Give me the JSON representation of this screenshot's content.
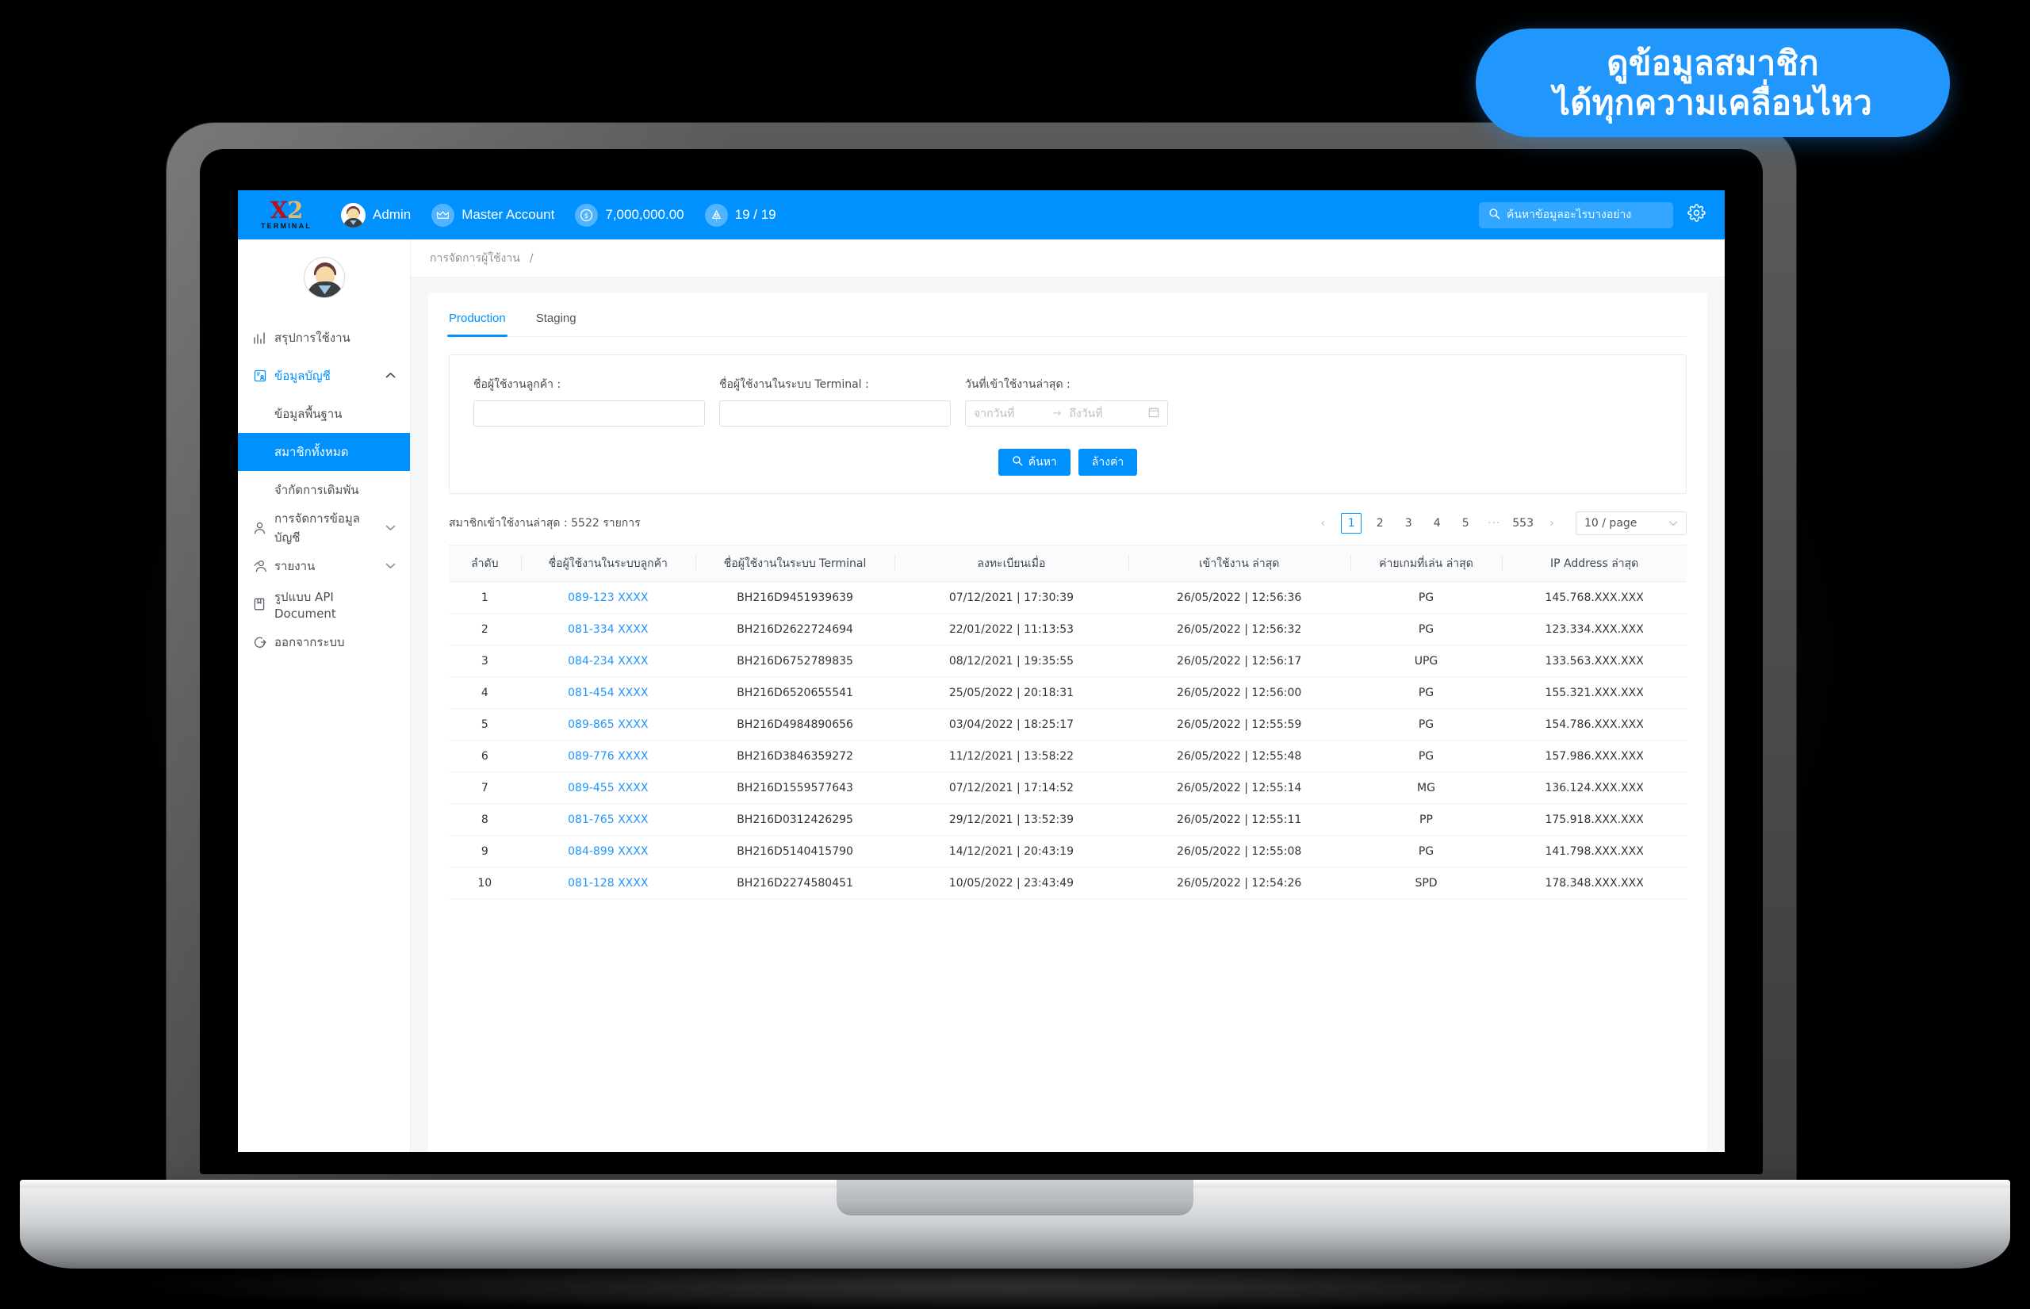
{
  "callout": {
    "line1": "ดูข้อมูลสมาชิก",
    "line2": "ได้ทุกความเคลื่อนไหว",
    "color": "#2196FC"
  },
  "header": {
    "logo_x": "X",
    "logo_two": "2",
    "logo_sub": "TERMINAL",
    "user_label": "Admin",
    "account_label": "Master Account",
    "balance": "7,000,000.00",
    "notify": "19 / 19",
    "search_placeholder": "ค้นหาข้อมูลอะไรบางอย่าง",
    "bg_color": "#0091FF",
    "icons": {
      "crown": "♛",
      "coin": "$",
      "bell": "△",
      "search": "search-icon",
      "gear": "gear-icon"
    }
  },
  "sidebar": {
    "items": [
      {
        "label": "สรุปการใช้งาน",
        "icon": "chart-bar-icon",
        "type": "item",
        "state": ""
      },
      {
        "label": "ข้อมูลบัญชี",
        "icon": "account-card-icon",
        "type": "group",
        "state": "open",
        "chevron": "⌃"
      },
      {
        "label": "ข้อมูลพื้นฐาน",
        "icon": "",
        "type": "sub",
        "state": ""
      },
      {
        "label": "สมาชิกทั้งหมด",
        "icon": "",
        "type": "sub",
        "state": "active"
      },
      {
        "label": "จำกัดการเดิมพัน",
        "icon": "",
        "type": "sub",
        "state": ""
      },
      {
        "label": "การจัดการข้อมูลบัญชี",
        "icon": "user-icon",
        "type": "group",
        "state": "",
        "chevron": "⌄"
      },
      {
        "label": "รายงาน",
        "icon": "users-report-icon",
        "type": "group",
        "state": "",
        "chevron": "⌄"
      },
      {
        "label": "รูปแบบ API Document",
        "icon": "book-icon",
        "type": "item",
        "state": ""
      },
      {
        "label": "ออกจากระบบ",
        "icon": "logout-icon",
        "type": "item",
        "state": ""
      }
    ]
  },
  "breadcrumb": {
    "item": "การจัดการผู้ใช้งาน",
    "separator": "/"
  },
  "tabs": [
    {
      "label": "Production",
      "active": true
    },
    {
      "label": "Staging",
      "active": false
    }
  ],
  "filters": {
    "customer_username": {
      "label": "ชื่อผู้ใช้งานลูกค้า :",
      "value": "",
      "placeholder": ""
    },
    "terminal_username": {
      "label": "ชื่อผู้ใช้งานในระบบ Terminal :",
      "value": "",
      "placeholder": ""
    },
    "last_login_date": {
      "label": "วันที่เข้าใช้งานล่าสุด :",
      "from_placeholder": "จากวันที่",
      "to_placeholder": "ถึงวันที่",
      "arrow": "→"
    },
    "search_button": "ค้นหา",
    "clear_button": "ล้างค่า"
  },
  "list": {
    "count_text": "สมาชิกเข้าใช้งานล่าสุด : 5522 รายการ",
    "pagination": {
      "prev": "‹",
      "next": "›",
      "pages": [
        "1",
        "2",
        "3",
        "4",
        "5"
      ],
      "dots": "···",
      "last": "553",
      "current": "1",
      "page_size": "10 / page",
      "chevron": "⌄"
    },
    "columns": [
      "ลำดับ",
      "ชื่อผู้ใช้งานในระบบลูกค้า",
      "ชื่อผู้ใช้งานในระบบ Terminal",
      "ลงทะเบียนเมื่อ",
      "เข้าใช้งาน ล่าสุด",
      "ค่ายเกมที่เล่น ล่าสุด",
      "IP Address ล่าสุด"
    ],
    "rows": [
      {
        "no": "1",
        "customer": "089-123 XXXX",
        "terminal": "BH216D9451939639",
        "registered": "07/12/2021 | 17:30:39",
        "last_login": "26/05/2022 | 12:56:36",
        "camp": "PG",
        "ip": "145.768.XXX.XXX"
      },
      {
        "no": "2",
        "customer": "081-334 XXXX",
        "terminal": "BH216D2622724694",
        "registered": "22/01/2022 | 11:13:53",
        "last_login": "26/05/2022 | 12:56:32",
        "camp": "PG",
        "ip": "123.334.XXX.XXX"
      },
      {
        "no": "3",
        "customer": "084-234 XXXX",
        "terminal": "BH216D6752789835",
        "registered": "08/12/2021 | 19:35:55",
        "last_login": "26/05/2022 | 12:56:17",
        "camp": "UPG",
        "ip": "133.563.XXX.XXX"
      },
      {
        "no": "4",
        "customer": "081-454 XXXX",
        "terminal": "BH216D6520655541",
        "registered": "25/05/2022 | 20:18:31",
        "last_login": "26/05/2022 | 12:56:00",
        "camp": "PG",
        "ip": "155.321.XXX.XXX"
      },
      {
        "no": "5",
        "customer": "089-865 XXXX",
        "terminal": "BH216D4984890656",
        "registered": "03/04/2022 | 18:25:17",
        "last_login": "26/05/2022 | 12:55:59",
        "camp": "PG",
        "ip": "154.786.XXX.XXX"
      },
      {
        "no": "6",
        "customer": "089-776 XXXX",
        "terminal": "BH216D3846359272",
        "registered": "11/12/2021 | 13:58:22",
        "last_login": "26/05/2022 | 12:55:48",
        "camp": "PG",
        "ip": "157.986.XXX.XXX"
      },
      {
        "no": "7",
        "customer": "089-455 XXXX",
        "terminal": "BH216D1559577643",
        "registered": "07/12/2021 | 17:14:52",
        "last_login": "26/05/2022 | 12:55:14",
        "camp": "MG",
        "ip": "136.124.XXX.XXX"
      },
      {
        "no": "8",
        "customer": "081-765 XXXX",
        "terminal": "BH216D0312426295",
        "registered": "29/12/2021 | 13:52:39",
        "last_login": "26/05/2022 | 12:55:11",
        "camp": "PP",
        "ip": "175.918.XXX.XXX"
      },
      {
        "no": "9",
        "customer": "084-899 XXXX",
        "terminal": "BH216D5140415790",
        "registered": "14/12/2021 | 20:43:19",
        "last_login": "26/05/2022 | 12:55:08",
        "camp": "PG",
        "ip": "141.798.XXX.XXX"
      },
      {
        "no": "10",
        "customer": "081-128 XXXX",
        "terminal": "BH216D2274580451",
        "registered": "10/05/2022 | 23:43:49",
        "last_login": "26/05/2022 | 12:54:26",
        "camp": "SPD",
        "ip": "178.348.XXX.XXX"
      }
    ]
  }
}
